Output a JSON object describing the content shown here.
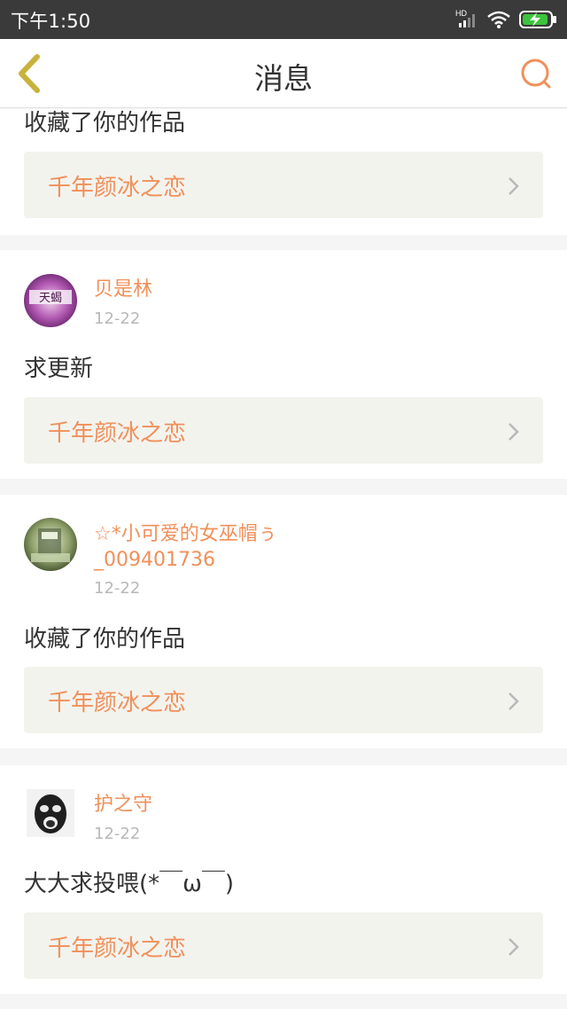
{
  "status_bar": {
    "time": "下午1:50",
    "network_label": "HD",
    "icons": [
      "signal-icon",
      "wifi-icon",
      "battery-charging-icon"
    ]
  },
  "header": {
    "title": "消息",
    "back_icon": "chevron-left-icon",
    "search_icon": "search-icon"
  },
  "colors": {
    "accent": "#f0905a",
    "back_icon": "#c8b23c",
    "card_bg": "#ffffff",
    "page_bg": "#f5f5f5",
    "work_bg": "#f3f3ee"
  },
  "messages": [
    {
      "text": "收藏了你的作品",
      "work_title": "千年颜冰之恋"
    },
    {
      "username": "贝是林",
      "date": "12-22",
      "text": "求更新",
      "work_title": "千年颜冰之恋",
      "avatar_text": "天蝎"
    },
    {
      "username_line1": "☆*小可爱的女巫帽ぅ",
      "username_line2": "_009401736",
      "date": "12-22",
      "text": "收藏了你的作品",
      "work_title": "千年颜冰之恋"
    },
    {
      "username": "护之守",
      "date": "12-22",
      "text": "大大求投喂(*￣ω￣)",
      "work_title": "千年颜冰之恋"
    }
  ]
}
